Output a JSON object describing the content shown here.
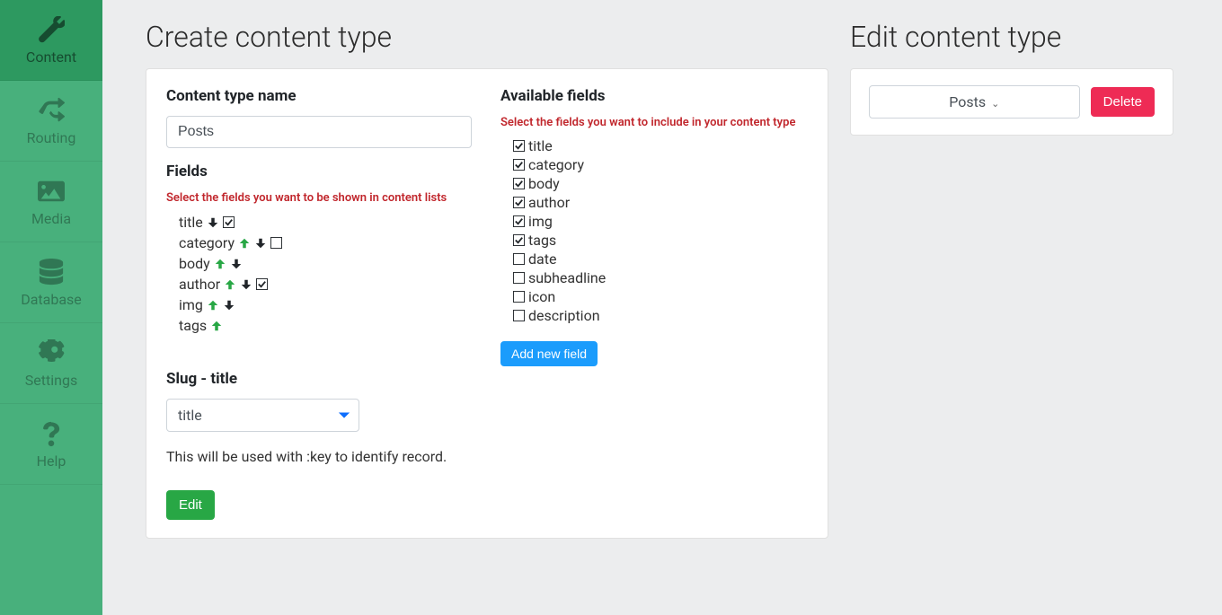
{
  "sidebar": {
    "items": [
      {
        "label": "Content",
        "icon": "wrench",
        "active": true
      },
      {
        "label": "Routing",
        "icon": "shuffle",
        "active": false
      },
      {
        "label": "Media",
        "icon": "image",
        "active": false
      },
      {
        "label": "Database",
        "icon": "database",
        "active": false
      },
      {
        "label": "Settings",
        "icon": "gear",
        "active": false
      },
      {
        "label": "Help",
        "icon": "question",
        "active": false
      }
    ]
  },
  "create": {
    "title": "Create content type",
    "name_label": "Content type name",
    "name_value": "Posts",
    "fields_label": "Fields",
    "fields_hint": "Select the fields you want to be shown in content lists",
    "fields": [
      {
        "label": "title",
        "up": false,
        "down": true,
        "checked": true
      },
      {
        "label": "category",
        "up": true,
        "down": true,
        "checked": false
      },
      {
        "label": "body",
        "up": true,
        "down": true,
        "checked": null
      },
      {
        "label": "author",
        "up": true,
        "down": true,
        "checked": true
      },
      {
        "label": "img",
        "up": true,
        "down": true,
        "checked": null
      },
      {
        "label": "tags",
        "up": true,
        "down": false,
        "checked": null
      }
    ],
    "slug_label": "Slug - title",
    "slug_value": "title",
    "slug_note": "This will be used with :key to identify record.",
    "submit_label": "Edit",
    "available": {
      "label": "Available fields",
      "hint": "Select the fields you want to include in your content type",
      "options": [
        {
          "label": "title",
          "checked": true
        },
        {
          "label": "category",
          "checked": true
        },
        {
          "label": "body",
          "checked": true
        },
        {
          "label": "author",
          "checked": true
        },
        {
          "label": "img",
          "checked": true
        },
        {
          "label": "tags",
          "checked": true
        },
        {
          "label": "date",
          "checked": false
        },
        {
          "label": "subheadline",
          "checked": false
        },
        {
          "label": "icon",
          "checked": false
        },
        {
          "label": "description",
          "checked": false
        }
      ],
      "add_label": "Add new field"
    }
  },
  "edit": {
    "title": "Edit content type",
    "selected": "Posts",
    "delete_label": "Delete"
  }
}
